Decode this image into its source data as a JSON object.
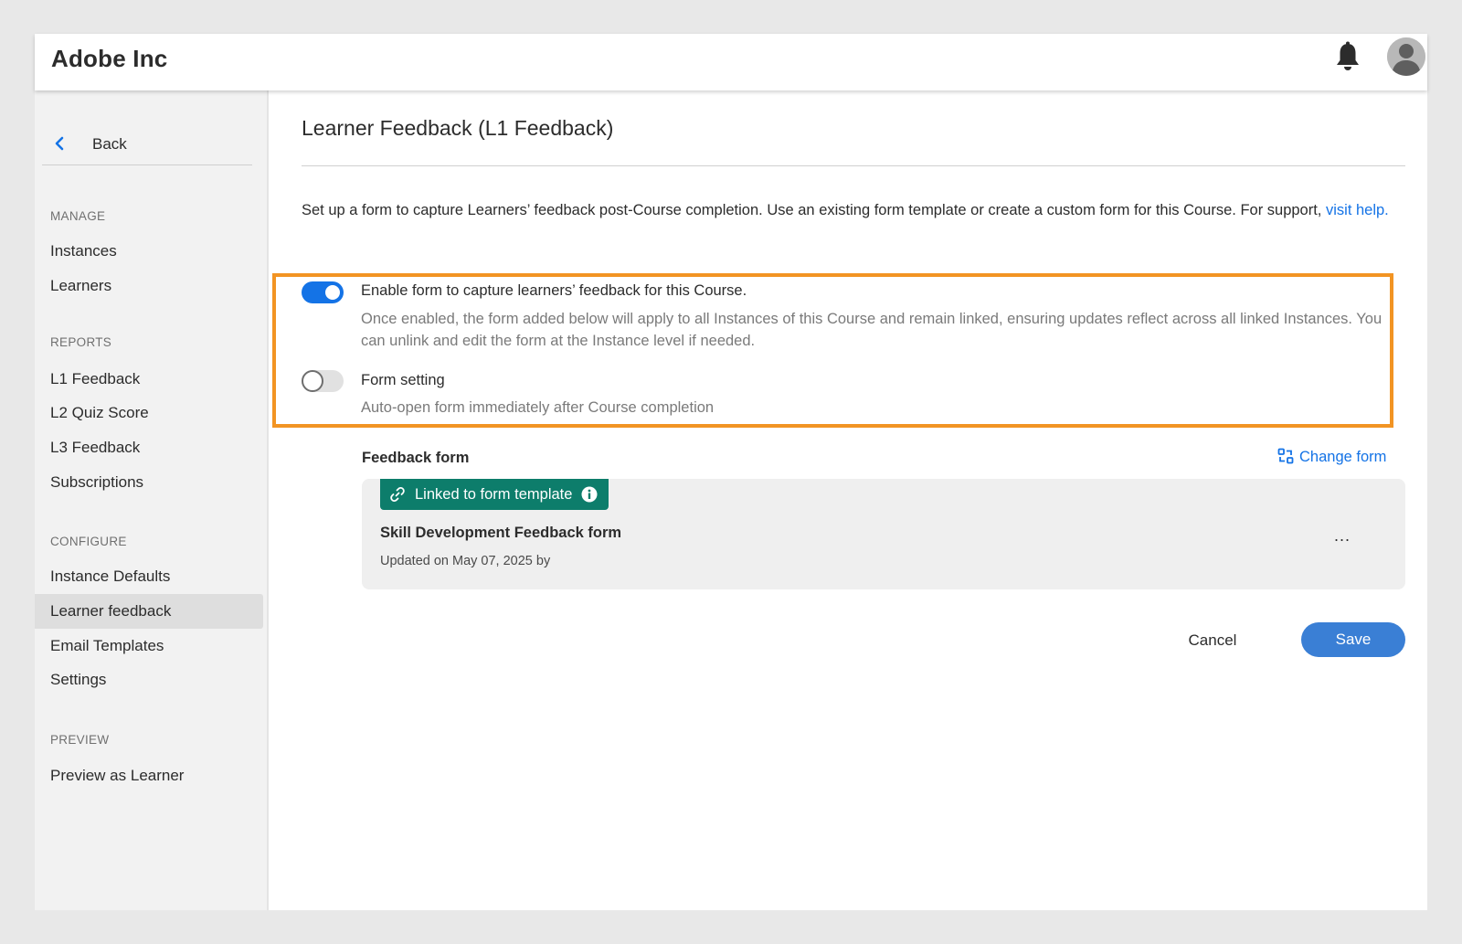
{
  "header": {
    "app_title": "Adobe Inc"
  },
  "sidebar": {
    "back_label": "Back",
    "sections": [
      {
        "label": "MANAGE",
        "items": [
          "Instances",
          "Learners"
        ]
      },
      {
        "label": "REPORTS",
        "items": [
          "L1 Feedback",
          "L2 Quiz Score",
          "L3 Feedback",
          "Subscriptions"
        ]
      },
      {
        "label": "CONFIGURE",
        "items": [
          "Instance Defaults",
          "Learner feedback",
          "Email Templates",
          "Settings"
        ]
      },
      {
        "label": "PREVIEW",
        "items": [
          "Preview as Learner"
        ]
      }
    ],
    "active_item": "Learner feedback"
  },
  "main": {
    "page_title": "Learner Feedback (L1 Feedback)",
    "description": "Set up a form to capture Learners’ feedback post-Course completion. Use an existing form template or create a custom form for this Course. For support, ",
    "visit_help": "visit help.",
    "enable_toggle": {
      "on": true,
      "label": "Enable form to capture learners’ feedback for this Course.",
      "desc_line1": "Once enabled, the form added below will apply to all Instances of this Course and remain linked, ensuring updates reflect across all linked Instances. You",
      "desc_line2": "can unlink and edit the form at the Instance level if needed."
    },
    "form_setting_toggle": {
      "on": false,
      "label": "Form setting",
      "desc": "Auto-open form immediately after Course completion"
    },
    "feedback_form_label": "Feedback form",
    "change_form_label": "Change form",
    "form_card": {
      "badge_label": "Linked to form template",
      "form_name": "Skill Development Feedback form",
      "updated": "Updated on May 07, 2025 by",
      "more": "..."
    },
    "cancel_label": "Cancel",
    "save_label": "Save"
  },
  "colors": {
    "accent": "#1473e6",
    "highlight": "#f29423",
    "badge": "#0d7d6b",
    "save_button": "#3a7fd5"
  }
}
